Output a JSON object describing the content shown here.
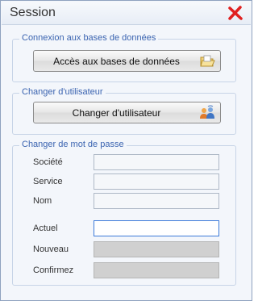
{
  "window": {
    "title": "Session"
  },
  "groups": {
    "databases": {
      "legend": "Connexion aux bases de données",
      "button_label": "Accès aux bases de données"
    },
    "user": {
      "legend": "Changer d'utilisateur",
      "button_label": "Changer d'utilisateur"
    },
    "password": {
      "legend": "Changer de mot de passe",
      "societe_label": "Société",
      "service_label": "Service",
      "nom_label": "Nom",
      "actuel_label": "Actuel",
      "nouveau_label": "Nouveau",
      "confirmez_label": "Confirmez",
      "societe_value": "",
      "service_value": "",
      "nom_value": "",
      "actuel_value": "",
      "nouveau_value": "",
      "confirmez_value": ""
    }
  },
  "icons": {
    "close": "close-x-icon",
    "folder": "folder-icon",
    "users": "users-icon"
  },
  "colors": {
    "legend_text": "#3a63b0",
    "close_red": "#e02020",
    "active_border": "#3d7bd9"
  }
}
